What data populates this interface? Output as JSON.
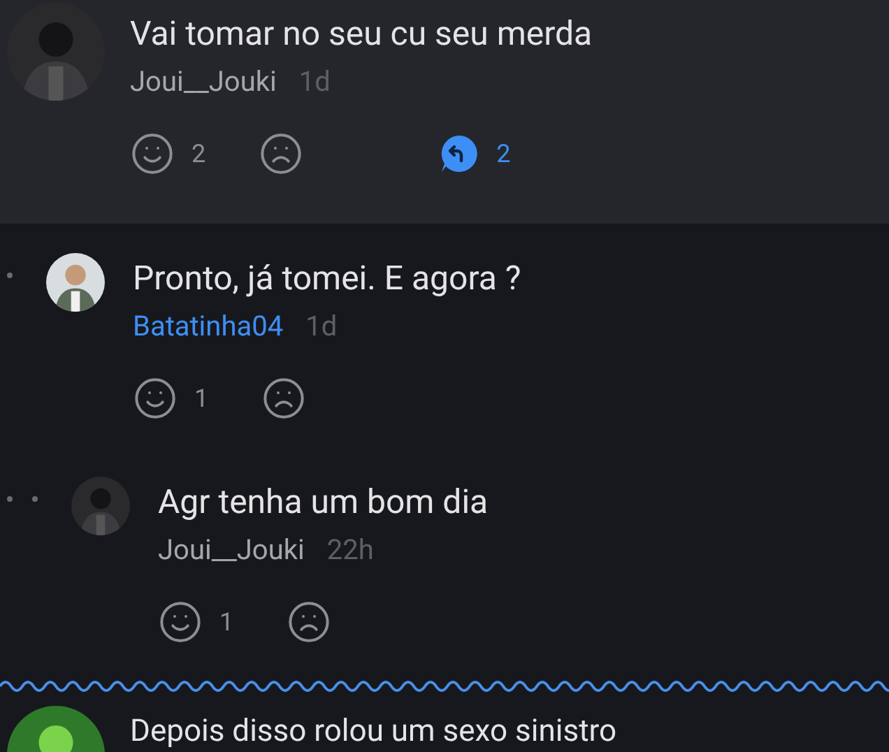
{
  "comments": [
    {
      "text": "Vai tomar no seu cu seu merda",
      "author": "Joui__Jouki",
      "author_highlighted": false,
      "time": "1d",
      "highlighted": true,
      "likes": "2",
      "reply_count": "2",
      "replies": [
        {
          "text": "Pronto, já tomei. E agora ?",
          "author": "Batatinha04",
          "author_highlighted": true,
          "time": "1d",
          "highlighted": false,
          "likes": "1",
          "replies": [
            {
              "text": "Agr tenha um bom dia",
              "author": "Joui__Jouki",
              "author_highlighted": false,
              "time": "22h",
              "highlighted": false,
              "likes": "1"
            }
          ]
        }
      ]
    }
  ],
  "more_comment": {
    "text": "Depois disso rolou um sexo sinistro"
  }
}
